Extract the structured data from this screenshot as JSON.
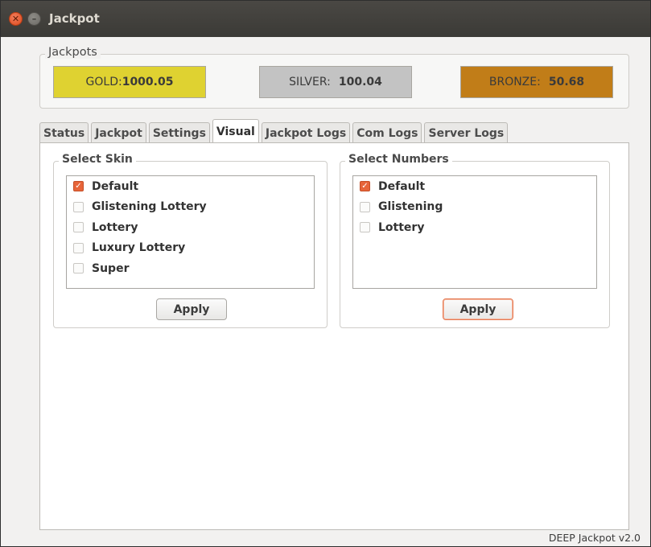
{
  "window": {
    "title": "Jackpot",
    "close_icon": "close-icon",
    "minimize_icon": "minimize-icon"
  },
  "jackpots": {
    "legend": "Jackpots",
    "gold": {
      "label": "GOLD:",
      "value": "1000.05",
      "color": "#dfd231"
    },
    "silver": {
      "label": "SILVER:",
      "value": "100.04",
      "color": "#c3c3c3"
    },
    "bronze": {
      "label": "BRONZE:",
      "value": "50.68",
      "color": "#c17d18"
    }
  },
  "tabs": [
    {
      "label": "Status"
    },
    {
      "label": "Jackpot"
    },
    {
      "label": "Settings"
    },
    {
      "label": "Visual",
      "active": true
    },
    {
      "label": "Jackpot Logs"
    },
    {
      "label": "Com Logs"
    },
    {
      "label": "Server Logs"
    }
  ],
  "visual": {
    "skin": {
      "legend": "Select Skin",
      "items": [
        {
          "label": "Default",
          "checked": true
        },
        {
          "label": "Glistening Lottery",
          "checked": false
        },
        {
          "label": "Lottery",
          "checked": false
        },
        {
          "label": "Luxury Lottery",
          "checked": false
        },
        {
          "label": "Super",
          "checked": false
        }
      ],
      "apply_label": "Apply"
    },
    "numbers": {
      "legend": "Select Numbers",
      "items": [
        {
          "label": "Default",
          "checked": true
        },
        {
          "label": "Glistening",
          "checked": false
        },
        {
          "label": "Lottery",
          "checked": false
        }
      ],
      "apply_label": "Apply"
    }
  },
  "footer": {
    "version": "DEEP Jackpot v2.0"
  },
  "colors": {
    "accent": "#e7653a",
    "titlebar": "#3b3a36"
  }
}
